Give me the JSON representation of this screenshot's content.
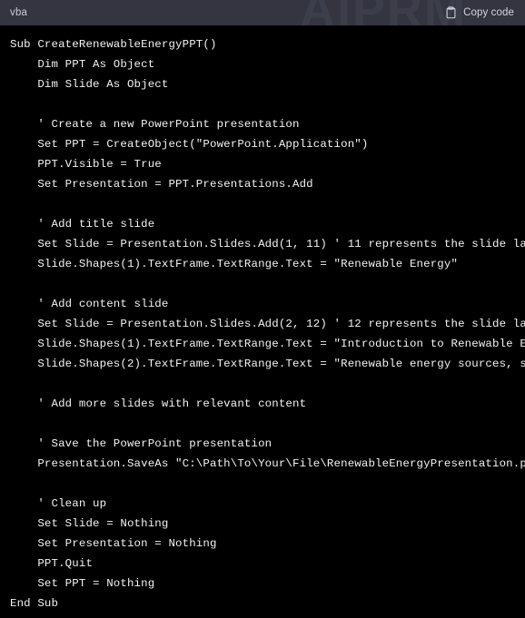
{
  "header": {
    "language_label": "vba",
    "copy_label": "Copy code",
    "copy_icon": "clipboard-icon",
    "watermark_text": "AIPRM",
    "background_color": "#343541",
    "text_color": "#d2d5dd"
  },
  "code_block": {
    "background_color": "#000000",
    "text_color": "#f2f2f2",
    "language": "vba",
    "content": "Sub CreateRenewableEnergyPPT()\n    Dim PPT As Object\n    Dim Slide As Object\n\n    ' Create a new PowerPoint presentation\n    Set PPT = CreateObject(\"PowerPoint.Application\")\n    PPT.Visible = True\n    Set Presentation = PPT.Presentations.Add\n\n    ' Add title slide\n    Set Slide = Presentation.Slides.Add(1, 11) ' 11 represents the slide layout\n    Slide.Shapes(1).TextFrame.TextRange.Text = \"Renewable Energy\"\n\n    ' Add content slide\n    Set Slide = Presentation.Slides.Add(2, 12) ' 12 represents the slide layout\n    Slide.Shapes(1).TextFrame.TextRange.Text = \"Introduction to Renewable Energy\"\n    Slide.Shapes(2).TextFrame.TextRange.Text = \"Renewable energy sources, such as solar\"\n\n    ' Add more slides with relevant content\n\n    ' Save the PowerPoint presentation\n    Presentation.SaveAs \"C:\\Path\\To\\Your\\File\\RenewableEnergyPresentation.pptx\"\n\n    ' Clean up\n    Set Slide = Nothing\n    Set Presentation = Nothing\n    PPT.Quit\n    Set PPT = Nothing\nEnd Sub"
  }
}
